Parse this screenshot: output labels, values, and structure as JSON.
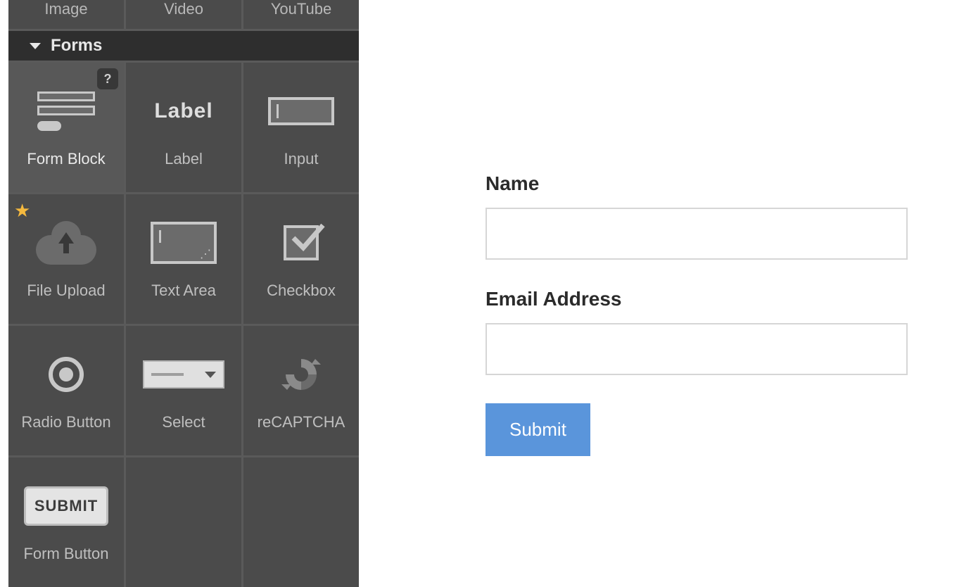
{
  "panel": {
    "media_row": [
      "Image",
      "Video",
      "YouTube"
    ],
    "section_title": "Forms",
    "tiles": [
      {
        "id": "form-block",
        "label": "Form Block",
        "selected": true,
        "help": "?"
      },
      {
        "id": "label",
        "label": "Label"
      },
      {
        "id": "input",
        "label": "Input"
      },
      {
        "id": "file-upload",
        "label": "File Upload",
        "starred": true
      },
      {
        "id": "text-area",
        "label": "Text Area"
      },
      {
        "id": "checkbox",
        "label": "Checkbox"
      },
      {
        "id": "radio-button",
        "label": "Radio Button"
      },
      {
        "id": "select",
        "label": "Select"
      },
      {
        "id": "recaptcha",
        "label": "reCAPTCHA"
      },
      {
        "id": "form-button",
        "label": "Form Button",
        "button_text": "SUBMIT"
      }
    ]
  },
  "form": {
    "fields": [
      {
        "label": "Name"
      },
      {
        "label": "Email Address"
      }
    ],
    "submit_label": "Submit"
  },
  "colors": {
    "accent": "#5a95db"
  }
}
